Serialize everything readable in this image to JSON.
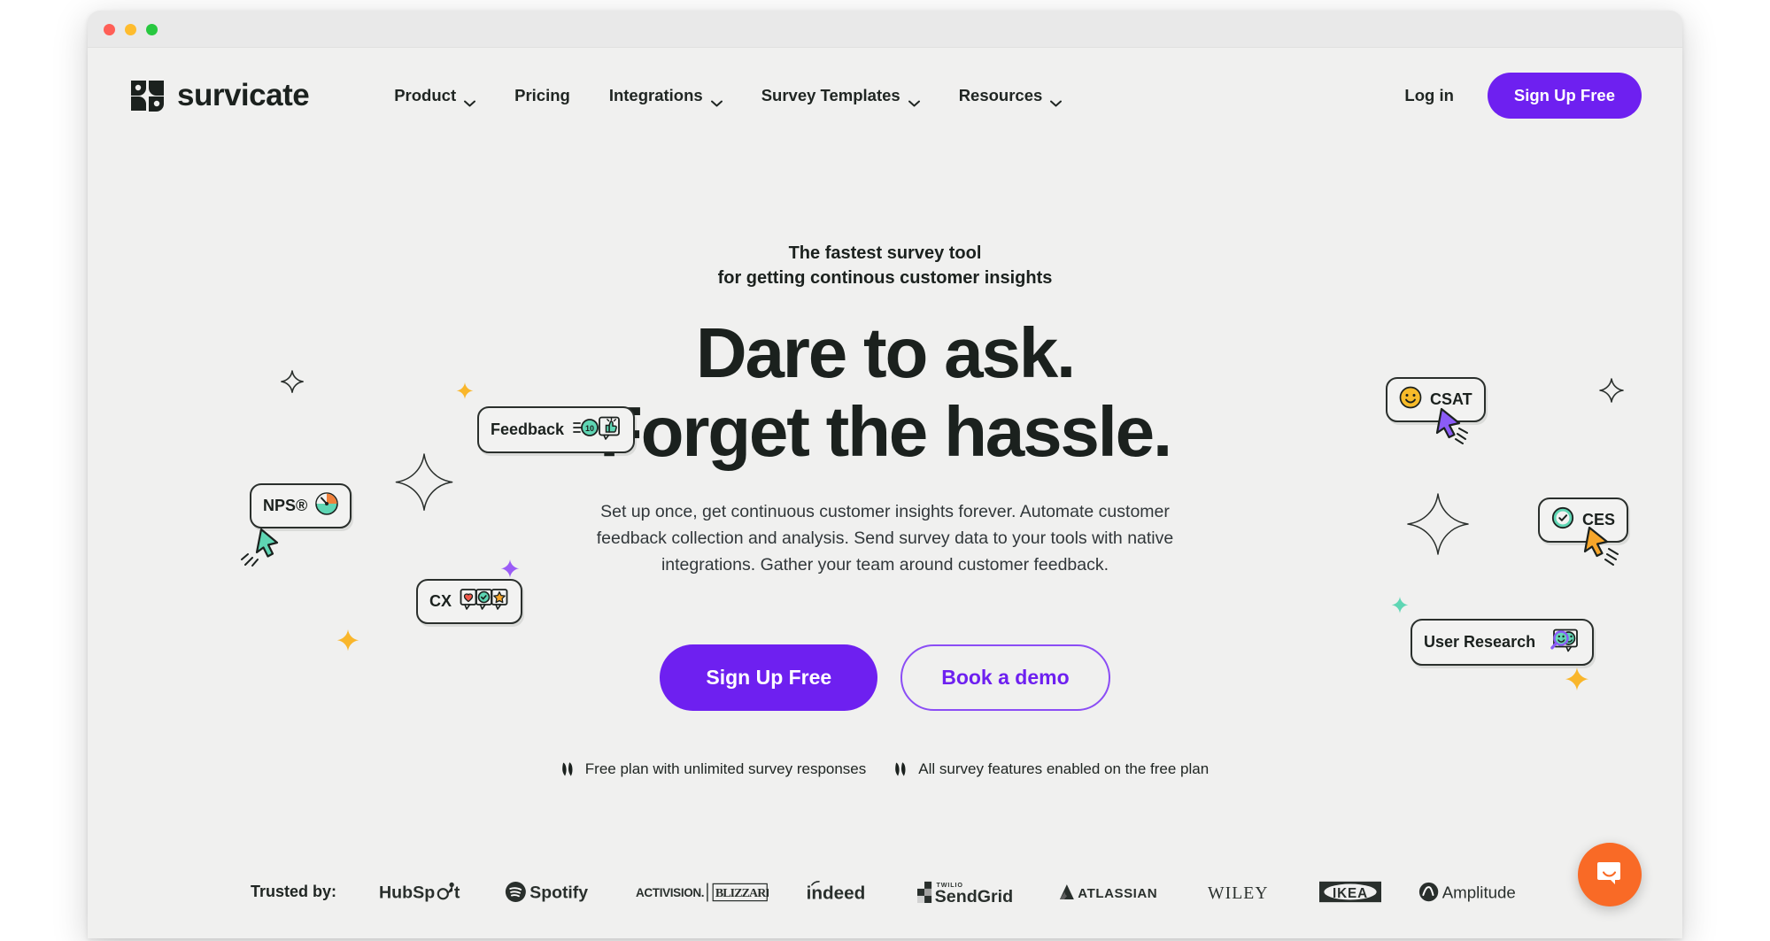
{
  "window": {
    "traffic_lights": [
      "close",
      "minimize",
      "maximize"
    ]
  },
  "nav": {
    "brand": "survicate",
    "links": [
      {
        "label": "Product",
        "has_dropdown": true
      },
      {
        "label": "Pricing",
        "has_dropdown": false
      },
      {
        "label": "Integrations",
        "has_dropdown": true
      },
      {
        "label": "Survey Templates",
        "has_dropdown": true
      },
      {
        "label": "Resources",
        "has_dropdown": true
      }
    ],
    "login_label": "Log in",
    "signup_label": "Sign Up Free"
  },
  "hero": {
    "eyebrow_line1": "The fastest survey tool",
    "eyebrow_line2": "for getting continous customer insights",
    "headline_line1": "Dare to ask.",
    "headline_line2": "Forget the hassle.",
    "subcopy": "Set up once, get continuous customer insights forever. Automate customer feedback collection and analysis. Send survey data to your tools with native integrations. Gather your team around customer feedback.",
    "cta_primary": "Sign Up Free",
    "cta_secondary": "Book a demo",
    "perks": [
      "Free plan with unlimited survey responses",
      "All survey features enabled on the free plan"
    ]
  },
  "chips": [
    {
      "id": "nps",
      "label": "NPS®",
      "icon": "gauge-emoji"
    },
    {
      "id": "feedback",
      "label": "Feedback",
      "icon": "thumbs-up-bubble-icon"
    },
    {
      "id": "cx",
      "label": "CX",
      "icon": "rating-bubbles-icon"
    },
    {
      "id": "csat",
      "label": "CSAT",
      "icon": "smiley-emoji"
    },
    {
      "id": "ces",
      "label": "CES",
      "icon": "check-circle-icon"
    },
    {
      "id": "ur",
      "label": "User Research",
      "icon": "magnifier-faces-icon"
    }
  ],
  "trusted": {
    "label": "Trusted by:",
    "logos": [
      "HubSpot",
      "Spotify",
      "ACTIVISION BLIZZARD",
      "indeed",
      "TWILIO SendGrid",
      "ATLASSIAN",
      "WILEY",
      "IKEA",
      "Amplitude"
    ]
  },
  "chat": {
    "name": "Intercom messenger launcher"
  },
  "colors": {
    "brand_purple": "#6E20F0",
    "page_bg": "#f0f0ef",
    "ink": "#1b211e",
    "mint": "#5fd6b4",
    "orange": "#f7a62a",
    "chat_orange": "#f96a26",
    "sparkle_yellow": "#f9b62b",
    "sparkle_purple": "#9b5cf6"
  }
}
